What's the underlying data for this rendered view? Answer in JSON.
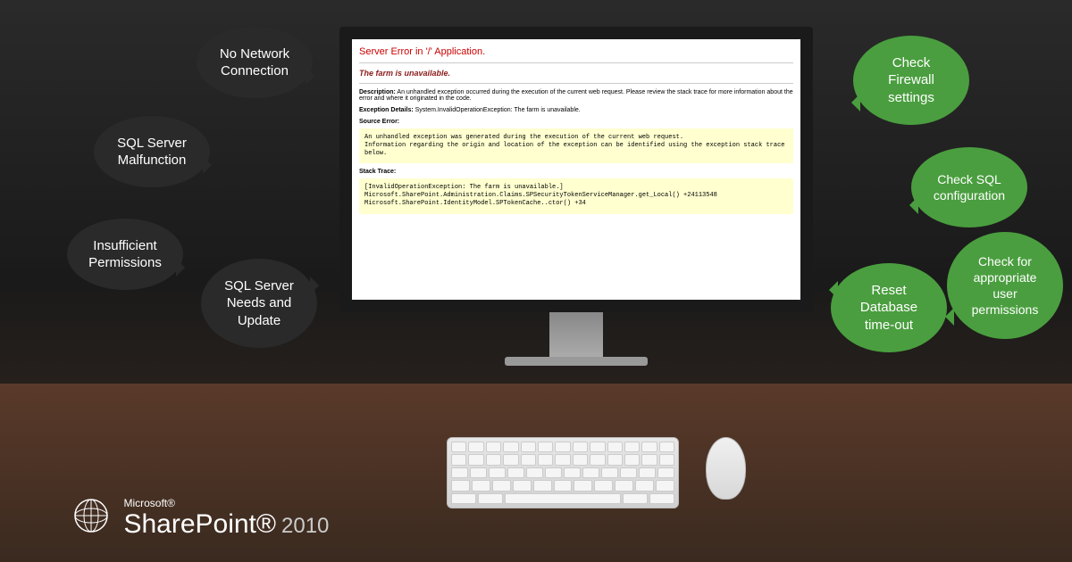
{
  "bubbles": {
    "left": [
      "No Network Connection",
      "SQL Server Malfunction",
      "Insufficient Permissions",
      "SQL Server Needs and Update"
    ],
    "right": [
      "Check Firewall settings",
      "Check SQL configuration",
      "Reset Database time-out",
      "Check for appropriate user permissions"
    ]
  },
  "error": {
    "title": "Server Error in '/' Application.",
    "subtitle": "The farm is unavailable.",
    "description_label": "Description:",
    "description": "An unhandled exception occurred during the execution of the current web request. Please review the stack trace for more information about the error and where it originated in the code.",
    "exception_label": "Exception Details:",
    "exception": "System.InvalidOperationException: The farm is unavailable.",
    "source_error_label": "Source Error:",
    "source_error": "An unhandled exception was generated during the execution of the current web request.\nInformation regarding the origin and location of the exception can be identified using the exception stack trace below.",
    "stack_trace_label": "Stack Trace:",
    "stack_trace": "[InvalidOperationException: The farm is unavailable.]\n  Microsoft.SharePoint.Administration.Claims.SPSecurityTokenServiceManager.get_Local() +24113548\n  Microsoft.SharePoint.IdentityModel.SPTokenCache..ctor() +34"
  },
  "logo": {
    "company": "Microsoft®",
    "product": "SharePoint®",
    "year": "2010"
  }
}
